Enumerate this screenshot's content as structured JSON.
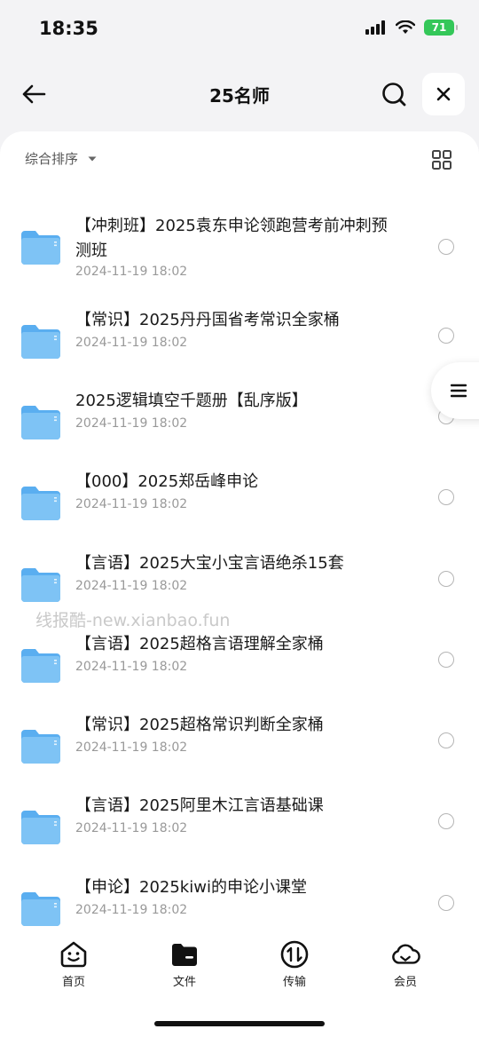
{
  "status": {
    "time": "18:35",
    "battery": "71"
  },
  "header": {
    "title": "25名师"
  },
  "toolbar": {
    "sort_label": "综合排序"
  },
  "files": [
    {
      "name": "【冲刺班】2025袁东申论领跑营考前冲刺预测班",
      "date": "2024-11-19 18:02"
    },
    {
      "name": "【常识】2025丹丹国省考常识全家桶",
      "date": "2024-11-19 18:02"
    },
    {
      "name": "2025逻辑填空千题册【乱序版】",
      "date": "2024-11-19 18:02"
    },
    {
      "name": "【000】2025郑岳峰申论",
      "date": "2024-11-19 18:02"
    },
    {
      "name": "【言语】2025大宝小宝言语绝杀15套",
      "date": "2024-11-19 18:02"
    },
    {
      "name": "【言语】2025超格言语理解全家桶",
      "date": "2024-11-19 18:02"
    },
    {
      "name": "【常识】2025超格常识判断全家桶",
      "date": "2024-11-19 18:02"
    },
    {
      "name": "【言语】2025阿里木江言语基础课",
      "date": "2024-11-19 18:02"
    },
    {
      "name": "【申论】2025kiwi的申论小课堂",
      "date": "2024-11-19 18:02"
    }
  ],
  "watermark": "线报酷-new.xianbao.fun",
  "tabs": [
    {
      "label": "首页",
      "icon": "home-smile-icon"
    },
    {
      "label": "文件",
      "icon": "folder-icon"
    },
    {
      "label": "传输",
      "icon": "transfer-icon"
    },
    {
      "label": "会员",
      "icon": "cloud-icon"
    }
  ],
  "colors": {
    "folder": "#7ec3f5",
    "battery": "#34c759",
    "accent": "#111111"
  }
}
